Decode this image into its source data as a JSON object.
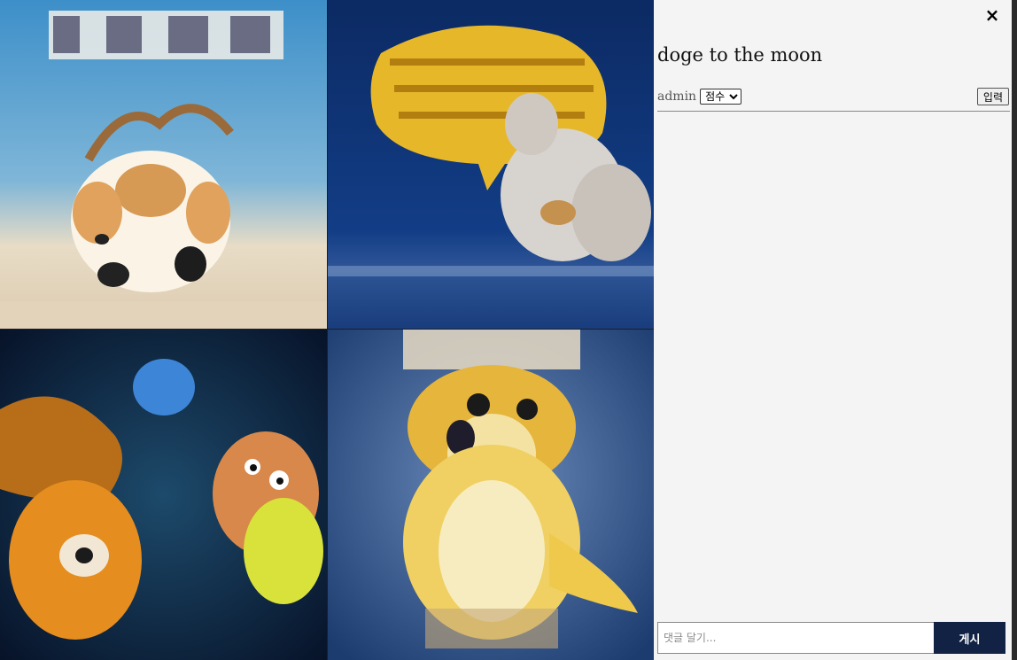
{
  "gallery": {
    "images": [
      {
        "name": "generated-image-1"
      },
      {
        "name": "generated-image-2"
      },
      {
        "name": "generated-image-3"
      },
      {
        "name": "generated-image-4"
      }
    ]
  },
  "panel": {
    "close_icon": "×",
    "title": "doge to the moon",
    "author": "admin",
    "score_select": {
      "selected": "점수",
      "options": [
        "점수"
      ]
    },
    "submit_label": "입력",
    "comment_placeholder": "댓글 달기...",
    "post_label": "게시"
  },
  "colors": {
    "panel_bg": "#f4f4f4",
    "post_button_bg": "#112244",
    "post_button_text": "#ffffff"
  }
}
